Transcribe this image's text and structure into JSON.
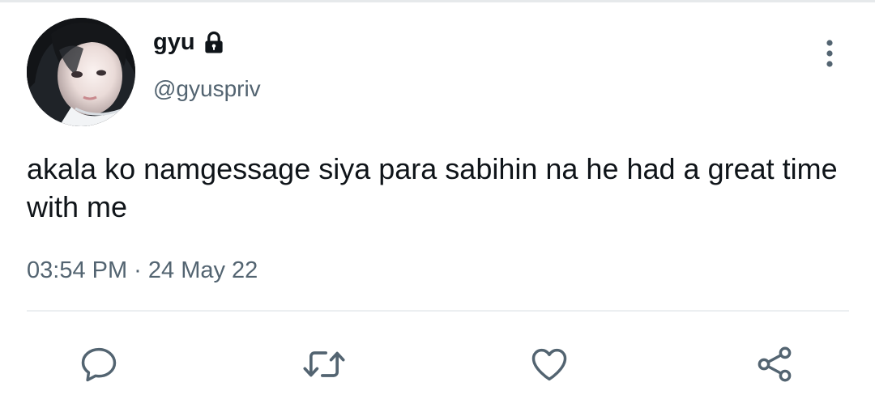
{
  "tweet": {
    "author": {
      "display_name": "gyu",
      "handle": "@gyuspriv",
      "protected_icon": "lock-icon",
      "avatar": "profile-photo"
    },
    "text": "akala ko namgessage siya para sabihin na he had a great time with me",
    "timestamp": "03:54 PM · 24 May 22",
    "menu_icon": "more-vertical-icon"
  },
  "actions": [
    {
      "name": "reply",
      "icon": "comment-icon"
    },
    {
      "name": "retweet",
      "icon": "retweet-icon"
    },
    {
      "name": "like",
      "icon": "heart-icon"
    },
    {
      "name": "share",
      "icon": "share-icon"
    }
  ],
  "colors": {
    "text_primary": "#0f1419",
    "text_secondary": "#536471",
    "icon": "#536471",
    "divider": "#eceff1"
  }
}
